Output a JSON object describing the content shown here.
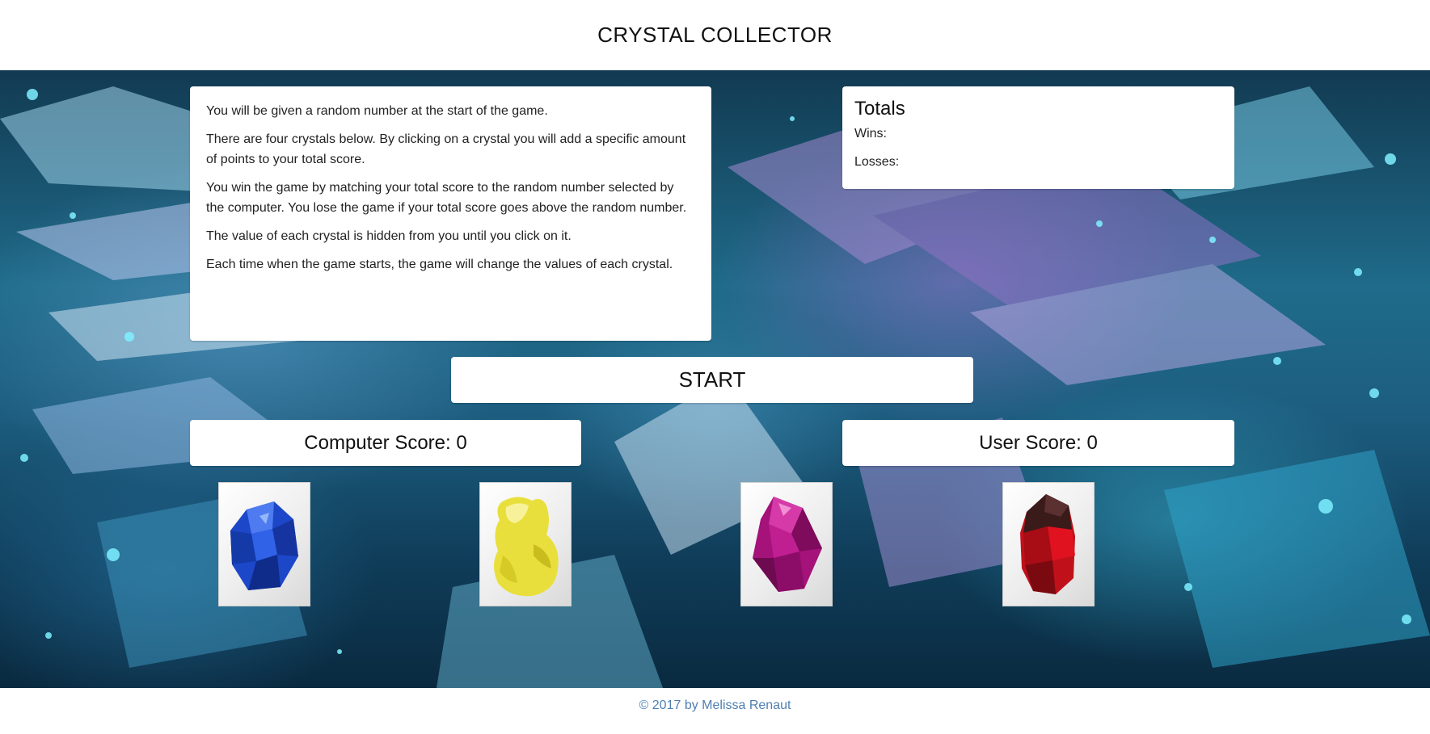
{
  "header": {
    "title": "CRYSTAL COLLECTOR"
  },
  "instructions": {
    "paragraphs": [
      "You will be given a random number at the start of the game.",
      "There are four crystals below. By clicking on a crystal you will add a specific amount of points to your total score.",
      "You win the game by matching your total score to the random number selected by the computer. You lose the game if your total score goes above the random number.",
      "The value of each crystal is hidden from you until you click on it.",
      "Each time when the game starts, the game will change the values of each crystal."
    ]
  },
  "totals": {
    "title": "Totals",
    "wins_label": "Wins:",
    "losses_label": "Losses:"
  },
  "start_button": {
    "label": "START"
  },
  "scores": {
    "computer": "Computer Score: 0",
    "user": "User Score: 0"
  },
  "crystals": [
    {
      "name": "blue-crystal",
      "color": "#1f4fd6"
    },
    {
      "name": "yellow-crystal",
      "color": "#e8df3a"
    },
    {
      "name": "purple-crystal",
      "color": "#b0187e"
    },
    {
      "name": "red-crystal",
      "color": "#c4131b"
    }
  ],
  "footer": {
    "text": "© 2017 by Melissa Renaut"
  }
}
